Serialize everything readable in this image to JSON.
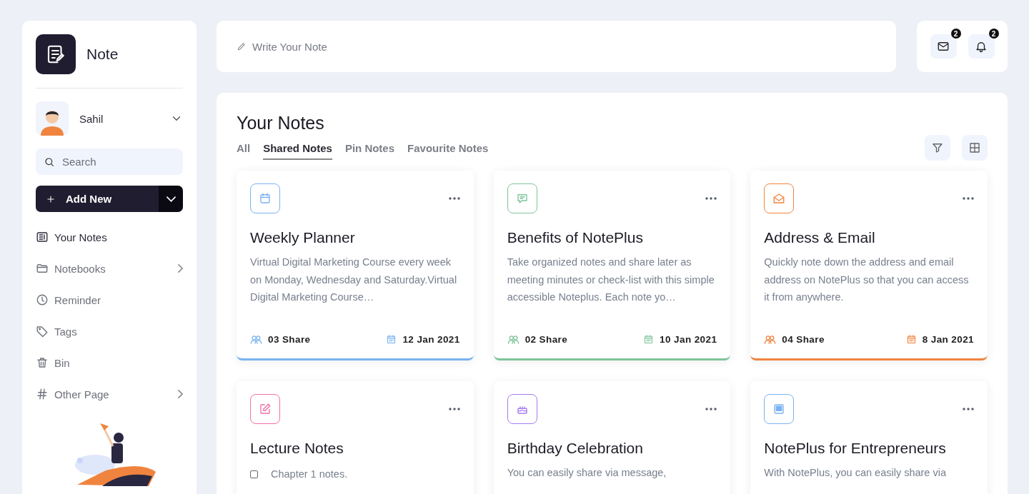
{
  "app": {
    "name": "Note"
  },
  "user": {
    "name": "Sahil"
  },
  "search": {
    "placeholder": "Search"
  },
  "add_button": {
    "label": "Add New"
  },
  "nav": [
    {
      "label": "Your Notes",
      "selected": true,
      "submenu": false
    },
    {
      "label": "Notebooks",
      "selected": false,
      "submenu": true
    },
    {
      "label": "Reminder",
      "selected": false,
      "submenu": false
    },
    {
      "label": "Tags",
      "selected": false,
      "submenu": false
    },
    {
      "label": "Bin",
      "selected": false,
      "submenu": false
    },
    {
      "label": "Other Page",
      "selected": false,
      "submenu": true
    }
  ],
  "note_input": {
    "placeholder": "Write Your Note"
  },
  "header_icons": [
    {
      "badge": "2"
    },
    {
      "badge": "2"
    }
  ],
  "panel": {
    "title": "Your Notes"
  },
  "tabs": [
    {
      "label": "All",
      "selected": false
    },
    {
      "label": "Shared Notes",
      "selected": true
    },
    {
      "label": "Pin Notes",
      "selected": false
    },
    {
      "label": "Favourite Notes",
      "selected": false
    }
  ],
  "cards": [
    {
      "kind": "text",
      "color": "#7ab2f0",
      "title": "Weekly Planner",
      "description": "Virtual Digital Marketing Course every week on Monday, Wednesday and Saturday.Virtual Digital Marketing Course…",
      "shares": "03 Share",
      "date": "12 Jan 2021"
    },
    {
      "kind": "text",
      "color": "#7fc49b",
      "title": "Benefits of NotePlus",
      "description": "Take organized notes and share later as meeting minutes or check-list with this simple accessible Noteplus. Each note yo…",
      "shares": "02 Share",
      "date": "10 Jan 2021"
    },
    {
      "kind": "text",
      "color": "#f0843f",
      "title": "Address & Email",
      "description": "Quickly note down the address and email address on NotePlus so that you can access it from anywhere.",
      "shares": "04 Share",
      "date": "8 Jan 2021"
    },
    {
      "kind": "checklist",
      "color": "#f06fa6",
      "title": "Lecture Notes",
      "items": [
        {
          "label": "Chapter 1 notes.",
          "checked": false
        }
      ]
    },
    {
      "kind": "text",
      "color": "#a67cf0",
      "title": "Birthday Celebration",
      "description": "You can easily share via message,"
    },
    {
      "kind": "text",
      "color": "#7ab2f0",
      "title": "NotePlus for Entrepreneurs",
      "description": "With NotePlus, you can easily share via"
    }
  ]
}
